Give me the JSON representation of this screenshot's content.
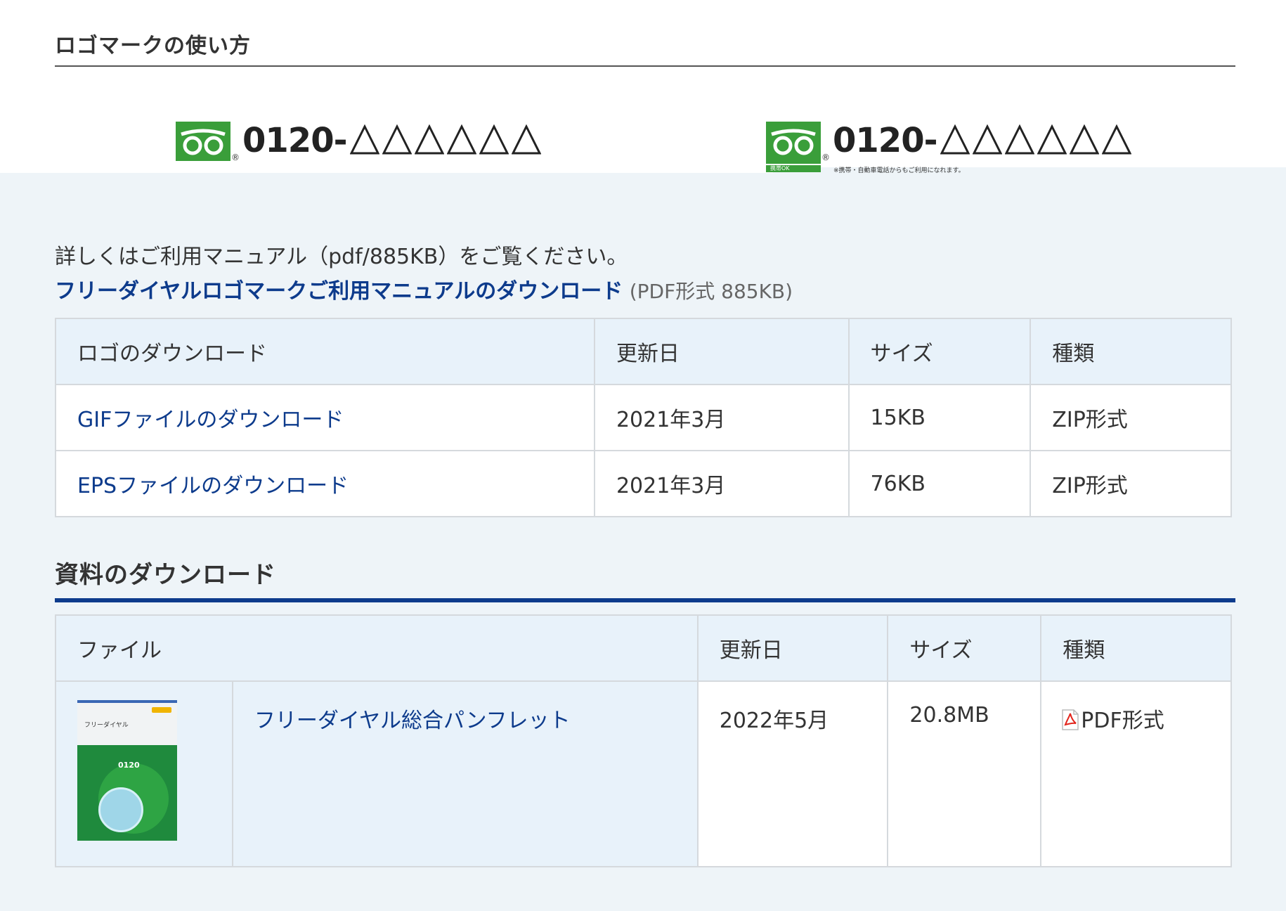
{
  "logo_section": {
    "title": "ロゴマークの使い方",
    "logos": [
      {
        "number": "0120-",
        "placeholder_marks": "△△△△△△",
        "band_text": "",
        "note": ""
      },
      {
        "number": "0120-",
        "placeholder_marks": "△△△△△△",
        "band_text": "携帯OK",
        "note": "※携帯・自動車電話からもご利用になれます。"
      }
    ]
  },
  "manual": {
    "detail_text": "詳しくはご利用マニュアル（pdf/885KB）をご覧ください。",
    "link_text": "フリーダイヤルロゴマークご利用マニュアルのダウンロード",
    "link_meta": "(PDF形式 885KB)"
  },
  "logo_table": {
    "headers": [
      "ロゴのダウンロード",
      "更新日",
      "サイズ",
      "種類"
    ],
    "rows": [
      {
        "name": "GIFファイルのダウンロード",
        "date": "2021年3月",
        "size": "15KB",
        "type": "ZIP形式"
      },
      {
        "name": "EPSファイルのダウンロード",
        "date": "2021年3月",
        "size": "76KB",
        "type": "ZIP形式"
      }
    ]
  },
  "docs_section": {
    "title": "資料のダウンロード",
    "headers": [
      "ファイル",
      "更新日",
      "サイズ",
      "種類"
    ],
    "rows": [
      {
        "name": "フリーダイヤル総合パンフレット",
        "date": "2022年5月",
        "size": "20.8MB",
        "type": "PDF形式",
        "thumb_title": "フリーダイヤル",
        "thumb_number": "0120"
      }
    ]
  },
  "colors": {
    "link": "#0d3b8c",
    "header_bg": "#e8f2fa",
    "page_bg": "#eef4f8",
    "logo_green": "#3a9e3a"
  },
  "icons": [
    "freedial-mark-icon",
    "pdf-file-icon"
  ]
}
